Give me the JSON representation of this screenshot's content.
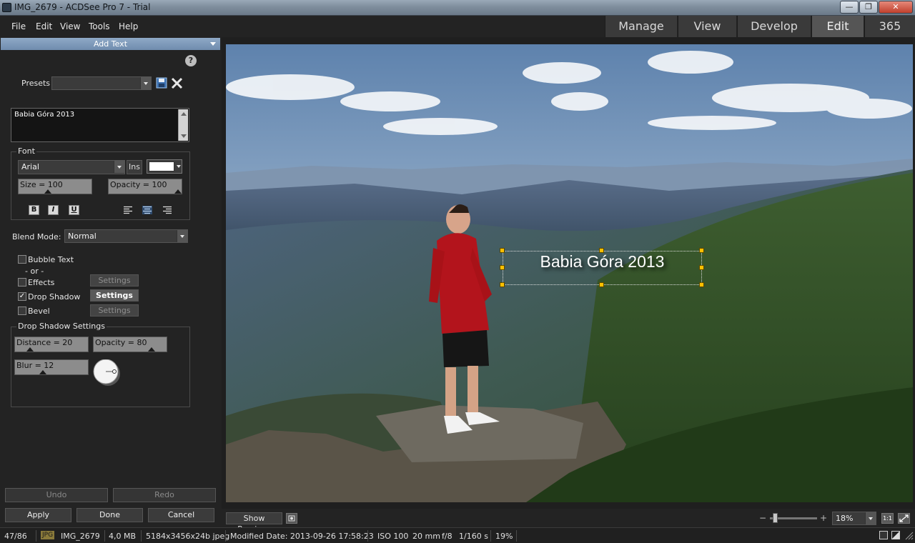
{
  "window": {
    "title": "IMG_2679 - ACDSee Pro 7 - Trial",
    "min": "—",
    "max": "❐",
    "close": "✕"
  },
  "menu": [
    "File",
    "Edit",
    "View",
    "Tools",
    "Help"
  ],
  "mode_tabs": [
    "Manage",
    "View",
    "Develop",
    "Edit",
    "365"
  ],
  "active_mode": "Edit",
  "panel": {
    "title": "Add Text",
    "help": "?",
    "presets_label": "Presets",
    "presets_value": "",
    "text_value": "Babia Góra 2013",
    "font_group": "Font",
    "font_name": "Arial",
    "ins_label": "Ins",
    "font_color": "#ffffff",
    "size_label": "Size = 100",
    "opacity_label": "Opacity = 100",
    "bold": "B",
    "italic": "I",
    "underline": "U",
    "blend_label": "Blend Mode:",
    "blend_value": "Normal",
    "bubble_text": "Bubble Text",
    "or": "- or -",
    "effects": "Effects",
    "drop_shadow": "Drop Shadow",
    "bevel": "Bevel",
    "settings": "Settings",
    "drop_shadow_checked": "✓",
    "ds_group": "Drop Shadow Settings",
    "distance_label": "Distance = 20",
    "ds_opacity_label": "Opacity = 80",
    "blur_label": "Blur = 12",
    "undo": "Undo",
    "redo": "Redo",
    "apply": "Apply",
    "done": "Done",
    "cancel": "Cancel"
  },
  "canvas": {
    "overlay_text": "Babia Góra 2013"
  },
  "bottom": {
    "show_previous": "Show Previous",
    "zoom": "18%",
    "one_to_one": "1:1",
    "minus": "−",
    "plus": "+"
  },
  "status": {
    "count": "47/86",
    "format": "JPG",
    "filename": "IMG_2679",
    "filesize": "4,0 MB",
    "dimensions": "5184x3456x24b jpeg",
    "modified": "Modified Date: 2013-09-26 17:58:23",
    "iso": "ISO 100",
    "focal": "20 mm",
    "aperture": "f/8",
    "shutter": "1/160 s",
    "zoom": "19%"
  }
}
